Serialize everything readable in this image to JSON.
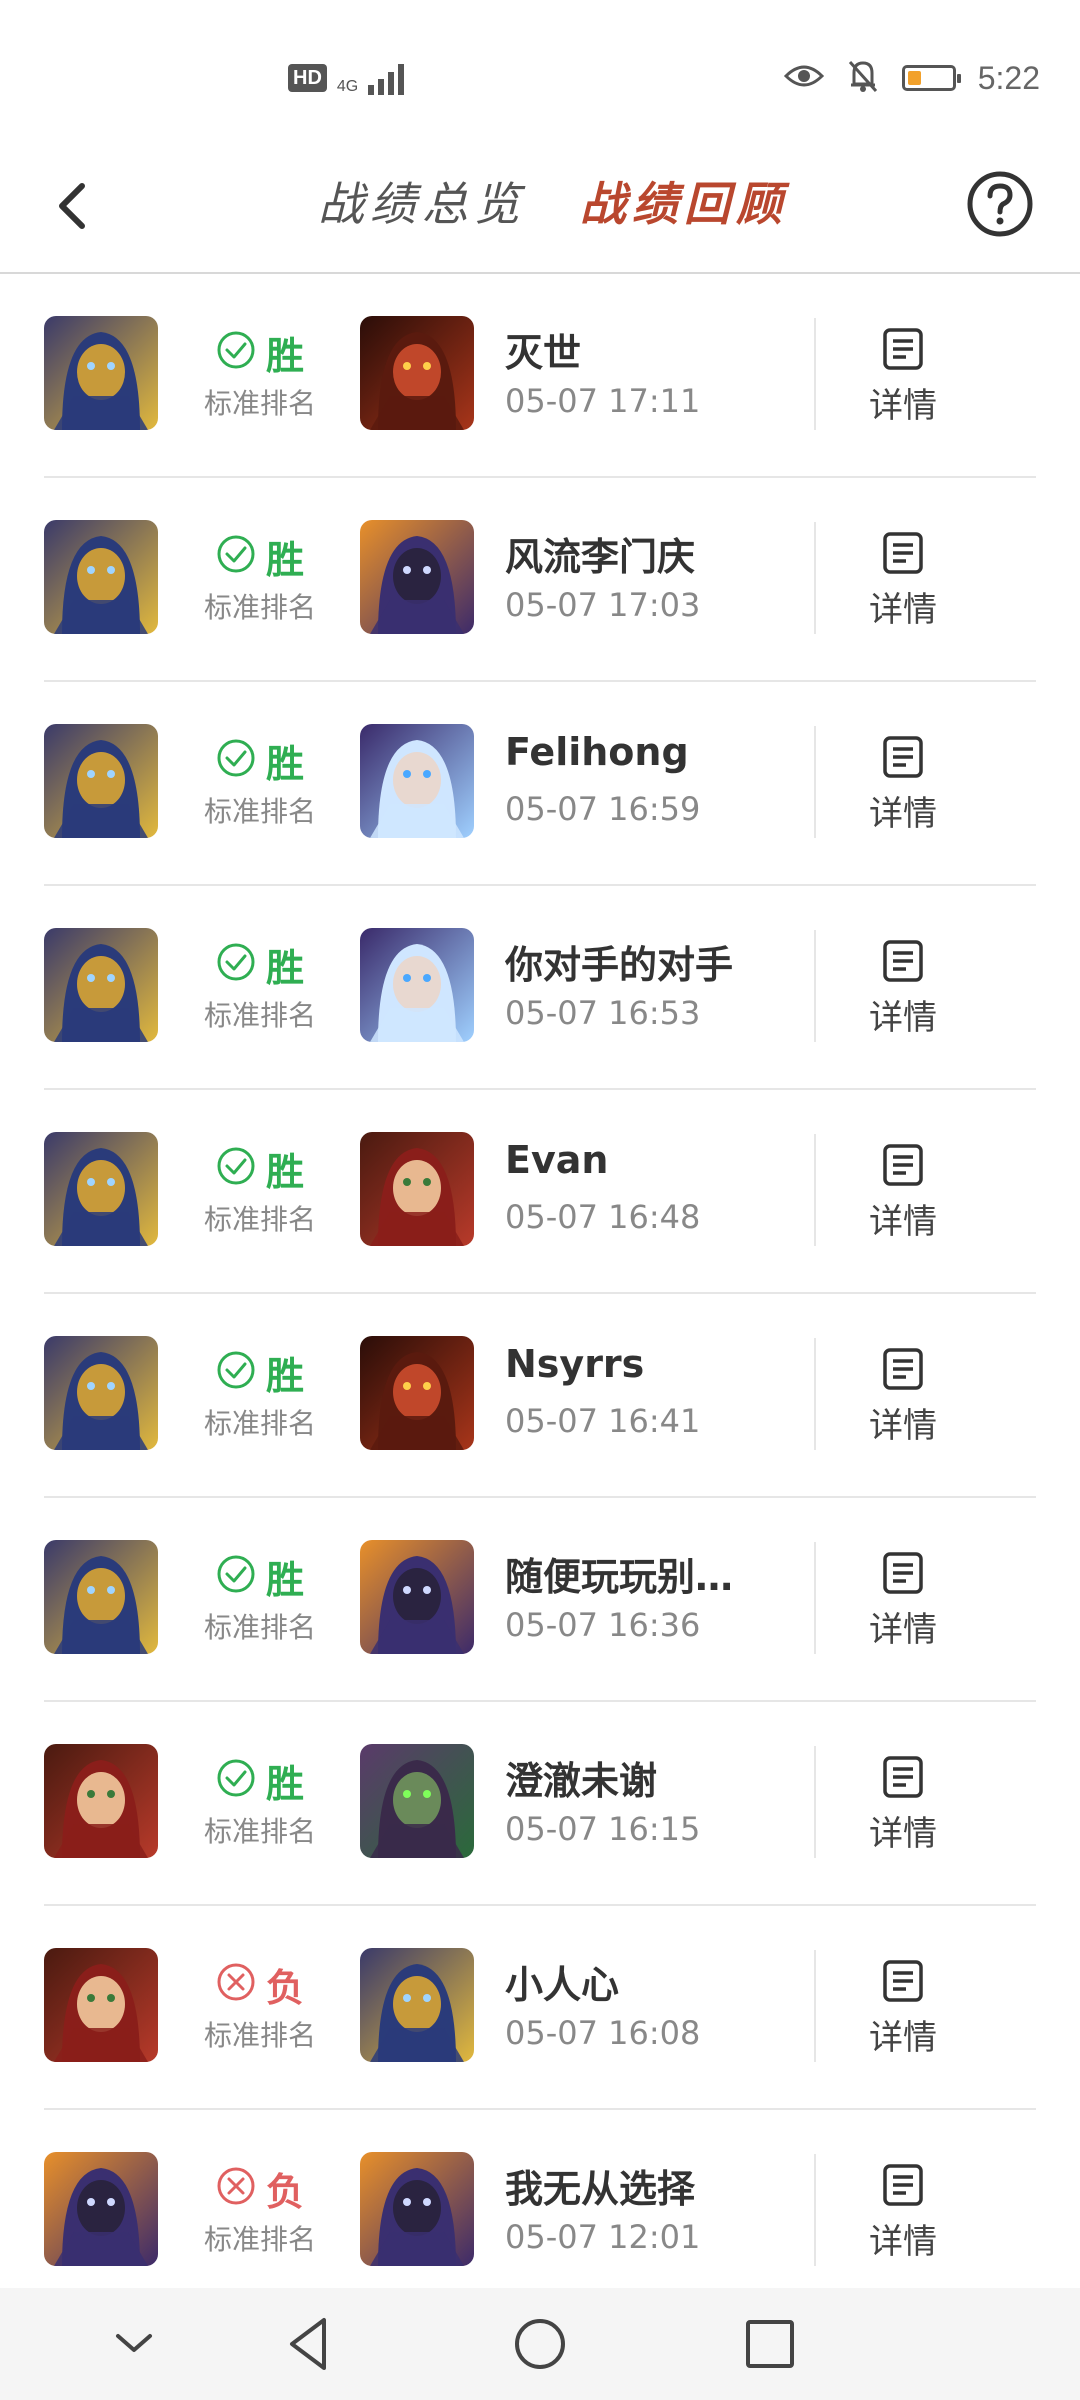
{
  "status_bar": {
    "hd": "HD",
    "network": "4G",
    "time": "5:22",
    "icons": [
      "signal-icon",
      "eye-icon",
      "mute-bell-icon",
      "battery-icon"
    ],
    "battery_level": 0.3,
    "battery_color": "#f2a12b"
  },
  "header": {
    "tab_overview": "战绩总览",
    "tab_review": "战绩回顾",
    "active_tab": "战绩回顾",
    "accent_color": "#b9472e"
  },
  "colors": {
    "win": "#2fae52",
    "lose": "#e06060"
  },
  "matches": [
    {
      "my_hero": "paladin-hero",
      "result": "胜",
      "win": true,
      "mode": "标准排名",
      "opp_hero": "warrior-hero",
      "opponent": "灭世",
      "time": "05-07 17:11",
      "detail": "详情"
    },
    {
      "my_hero": "paladin-hero",
      "result": "胜",
      "win": true,
      "mode": "标准排名",
      "opp_hero": "warlock-hero",
      "opponent": "风流李门庆",
      "time": "05-07 17:03",
      "detail": "详情"
    },
    {
      "my_hero": "paladin-hero",
      "result": "胜",
      "win": true,
      "mode": "标准排名",
      "opp_hero": "mage-hero",
      "opponent": "Felihong",
      "time": "05-07 16:59",
      "detail": "详情"
    },
    {
      "my_hero": "paladin-hero",
      "result": "胜",
      "win": true,
      "mode": "标准排名",
      "opp_hero": "mage-hero",
      "opponent": "你对手的对手",
      "time": "05-07 16:53",
      "detail": "详情"
    },
    {
      "my_hero": "paladin-hero",
      "result": "胜",
      "win": true,
      "mode": "标准排名",
      "opp_hero": "hunter-hero",
      "opponent": "Evan",
      "time": "05-07 16:48",
      "detail": "详情"
    },
    {
      "my_hero": "paladin-hero",
      "result": "胜",
      "win": true,
      "mode": "标准排名",
      "opp_hero": "warrior-hero",
      "opponent": "Nsyrrs",
      "time": "05-07 16:41",
      "detail": "详情"
    },
    {
      "my_hero": "paladin-hero",
      "result": "胜",
      "win": true,
      "mode": "标准排名",
      "opp_hero": "warlock-hero",
      "opponent": "随便玩玩别…",
      "time": "05-07 16:36",
      "detail": "详情"
    },
    {
      "my_hero": "hunter-hero",
      "result": "胜",
      "win": true,
      "mode": "标准排名",
      "opp_hero": "demon-hunter-hero",
      "opponent": "澄澈未谢",
      "time": "05-07 16:15",
      "detail": "详情"
    },
    {
      "my_hero": "hunter-hero",
      "result": "负",
      "win": false,
      "mode": "标准排名",
      "opp_hero": "paladin-hero",
      "opponent": "小人心",
      "time": "05-07 16:08",
      "detail": "详情"
    },
    {
      "my_hero": "warlock-hero",
      "result": "负",
      "win": false,
      "mode": "标准排名",
      "opp_hero": "warlock-hero",
      "opponent": "我无从选择",
      "time": "05-07 12:01",
      "detail": "详情"
    }
  ],
  "nav_bar": {
    "icons": [
      "collapse-chevron-icon",
      "back-triangle-icon",
      "home-circle-icon",
      "recents-square-icon"
    ]
  }
}
